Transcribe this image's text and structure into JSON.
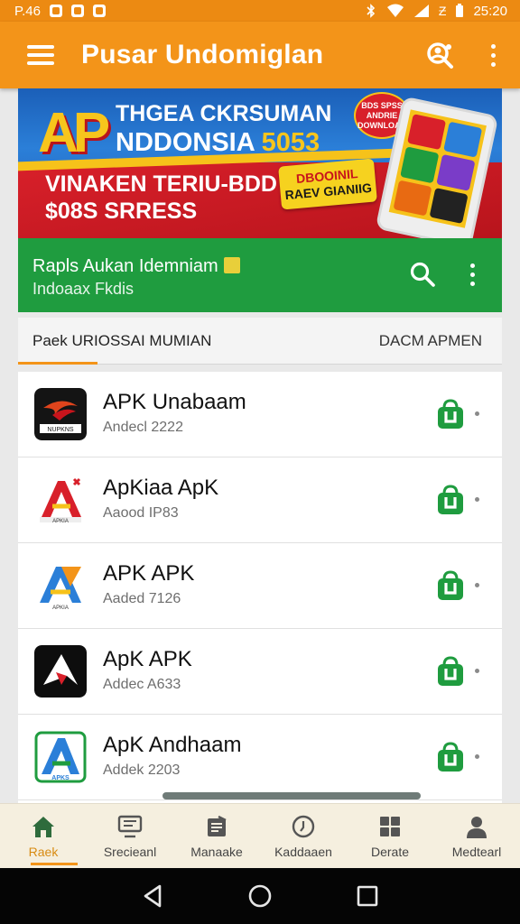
{
  "status_bar": {
    "left_text": "P.46",
    "right_text": "25:20",
    "right_glyph": "Ƶ"
  },
  "app_bar": {
    "title": "Pusar Undomiglan"
  },
  "banner": {
    "logo_text": "AP",
    "line1": "THGEA CKRSUMAN",
    "line2_prefix": "NDDONSIA ",
    "line2_highlight": "5053",
    "line3": "VINAKEN TERIU-BDD",
    "line4": "$08S SRRESS",
    "badge_red_text": "BDS SPSS ANDRIE DOWNLOAD",
    "badge_yellow_top": "DBOOINIL",
    "badge_yellow_bottom": "RAEV GIANIIG"
  },
  "section_header": {
    "title": "Rapls Aukan Idemniam",
    "subtitle": "Indoaax Fkdis"
  },
  "subtabs": {
    "left": "Paek  URIOSSAI MUMIAN",
    "right": "DACM APMEN"
  },
  "apps": [
    {
      "name": "APK Unabaam",
      "sub": "Andecl 2222",
      "icon_label": "NUPKNS"
    },
    {
      "name": "ApKiaa ApK",
      "sub": "Aaood IP83",
      "icon_label": "APKIA"
    },
    {
      "name": "APK APK",
      "sub": "Aaded 7126",
      "icon_label": "APKIA"
    },
    {
      "name": "ApK APK",
      "sub": "Addec A633",
      "icon_label": ""
    },
    {
      "name": "ApK Andhaam",
      "sub": "Addek 2203",
      "icon_label": "APKS"
    }
  ],
  "bottom_nav": [
    {
      "label": "Raek",
      "icon": "home-icon"
    },
    {
      "label": "Srecieanl",
      "icon": "screen-icon"
    },
    {
      "label": "Manaake",
      "icon": "manage-icon"
    },
    {
      "label": "Kaddaaen",
      "icon": "clock-icon"
    },
    {
      "label": "Derate",
      "icon": "grid-icon"
    },
    {
      "label": "Medtearl",
      "icon": "profile-icon"
    }
  ],
  "colors": {
    "app_bar": "#f39419",
    "section_green": "#1f9c3f",
    "download_green": "#1f9c3f",
    "active_nav": "#d88b12"
  }
}
